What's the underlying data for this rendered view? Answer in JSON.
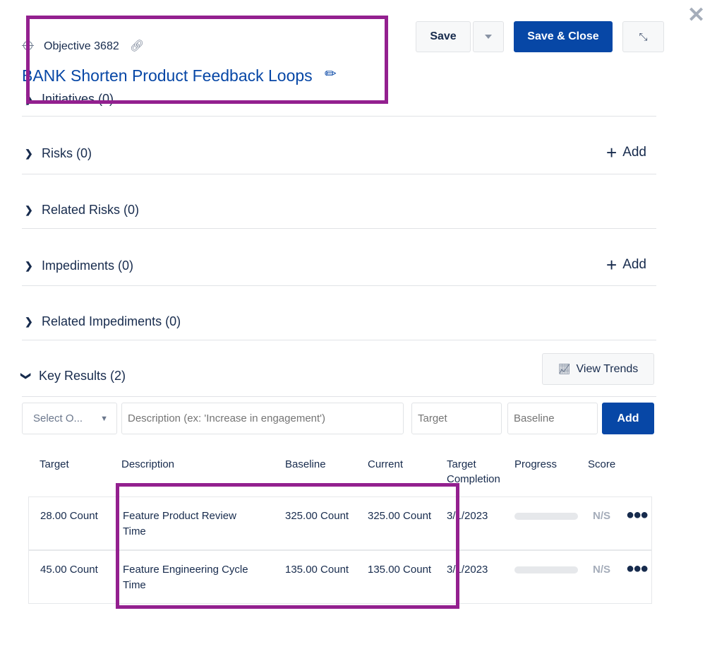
{
  "header": {
    "objective_id": "Objective 3682",
    "title": "BANK Shorten Product Feedback Loops",
    "icons": {
      "target": "crosshair-icon",
      "link": "link-icon",
      "edit": "pencil-icon"
    }
  },
  "toolbar": {
    "save": "Save",
    "save_close": "Save & Close"
  },
  "sections": [
    {
      "label": "Initiatives (0)"
    },
    {
      "label": "Risks (0)",
      "add": "Add"
    },
    {
      "label": "Related Risks (0)"
    },
    {
      "label": "Impediments (0)",
      "add": "Add"
    },
    {
      "label": "Related Impediments (0)"
    }
  ],
  "key_results": {
    "label": "Key Results (2)",
    "view_trends": "View Trends",
    "form": {
      "select_placeholder": "Select O...",
      "description_placeholder": "Description (ex: 'Increase in engagement')",
      "target_placeholder": "Target",
      "baseline_placeholder": "Baseline",
      "add": "Add"
    },
    "columns": {
      "target": "Target",
      "description": "Description",
      "baseline": "Baseline",
      "current": "Current",
      "target_completion_1": "Target",
      "target_completion_2": "Completion",
      "progress": "Progress",
      "score": "Score"
    },
    "rows": [
      {
        "target": "28.00 Count",
        "description_1": "Feature Product Review",
        "description_2": "Time",
        "baseline": "325.00 Count",
        "current": "325.00 Count",
        "target_completion": "3/1/2023",
        "progress": 0,
        "score": "N/S"
      },
      {
        "target": "45.00 Count",
        "description_1": "Feature Engineering Cycle",
        "description_2": "Time",
        "baseline": "135.00 Count",
        "current": "135.00 Count",
        "target_completion": "3/1/2023",
        "progress": 0,
        "score": "N/S"
      }
    ]
  },
  "colors": {
    "primary": "#0747a6",
    "annotation": "#93208f"
  }
}
